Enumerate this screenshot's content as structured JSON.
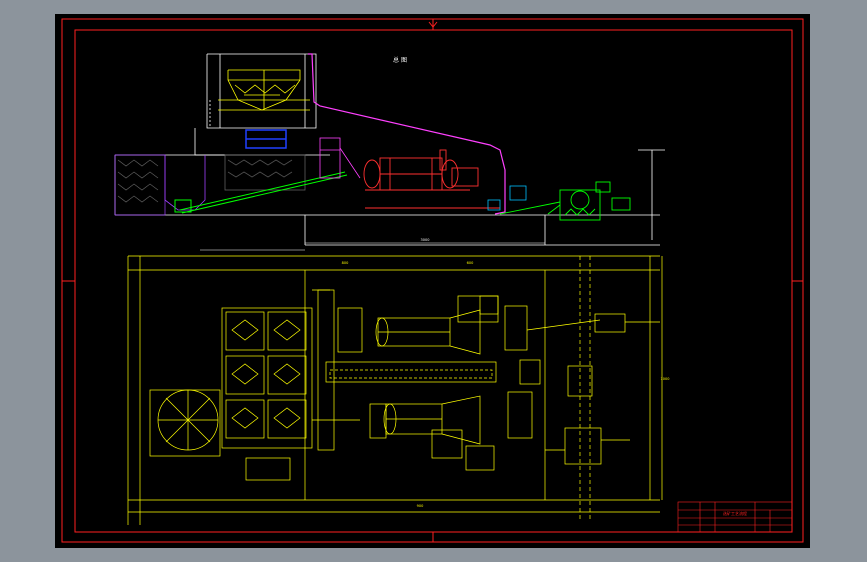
{
  "viewport": {
    "background": "#8c949c",
    "sheet_color": "#000000",
    "frame_color": "#ff2020"
  },
  "drawing": {
    "elevation_title": "总 图",
    "title_block_label": "选矿工艺流程",
    "dim_total": "3000",
    "dim_a": "800",
    "dim_b": "600",
    "dim_c": "900",
    "dim_d": "1000"
  },
  "colors": {
    "plan_lines": "#ffff00",
    "building_lines": "#ffffff",
    "conveyor_green": "#00ff00",
    "hopper_purple": "#a040ff",
    "pipe_magenta": "#ff40ff",
    "mill_red": "#ff3030",
    "equipment_cyan": "#00c0ff"
  }
}
